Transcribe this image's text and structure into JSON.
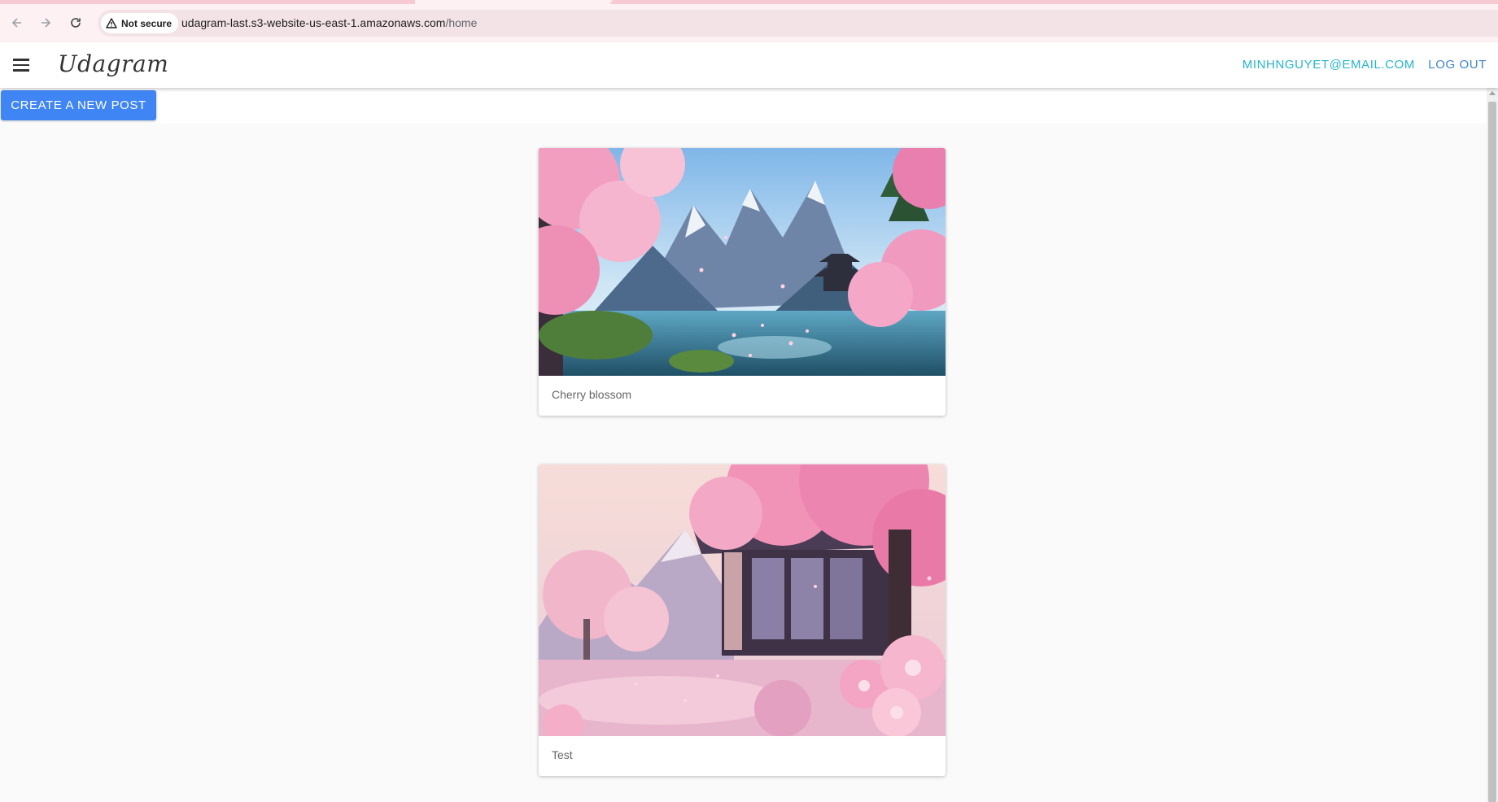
{
  "browser": {
    "security_label": "Not secure",
    "url_host": "udagram-last.s3-website-us-east-1.amazonaws.com",
    "url_path": "/home"
  },
  "app": {
    "logo": "Udagram",
    "user_email": "MINHNGUYET@EMAIL.COM",
    "logout_label": "LOG OUT",
    "create_post_label": "CREATE A NEW POST"
  },
  "feed": {
    "posts": [
      {
        "caption": "Cherry blossom",
        "image": "cherry-blossom-lake-pagoda"
      },
      {
        "caption": "Test",
        "image": "cherry-blossom-house"
      }
    ]
  },
  "colors": {
    "accent": "#3f85f4",
    "email": "#26b5c9",
    "logout": "#3f84c7",
    "browser_bar": "#fdf1f3"
  },
  "icons": [
    "back-arrow-icon",
    "forward-arrow-icon",
    "reload-icon",
    "warning-icon",
    "menu-icon"
  ]
}
